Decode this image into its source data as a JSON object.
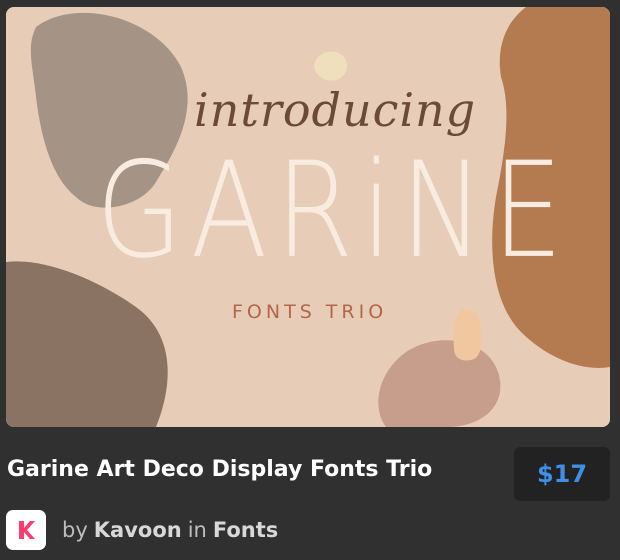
{
  "hero": {
    "script_word": "introducing",
    "display_word": "GARiNE",
    "subtitle": "FONTS TRIO"
  },
  "product": {
    "title": "Garine Art Deco Display Fonts Trio",
    "price": "$17"
  },
  "author": {
    "by_label": "by",
    "name": "Kavoon",
    "in_label": "in",
    "category": "Fonts",
    "avatar_letter": "K"
  },
  "colors": {
    "background": "#303030",
    "price": "#3f8ee8",
    "avatar_accent": "#ff3b6e"
  }
}
